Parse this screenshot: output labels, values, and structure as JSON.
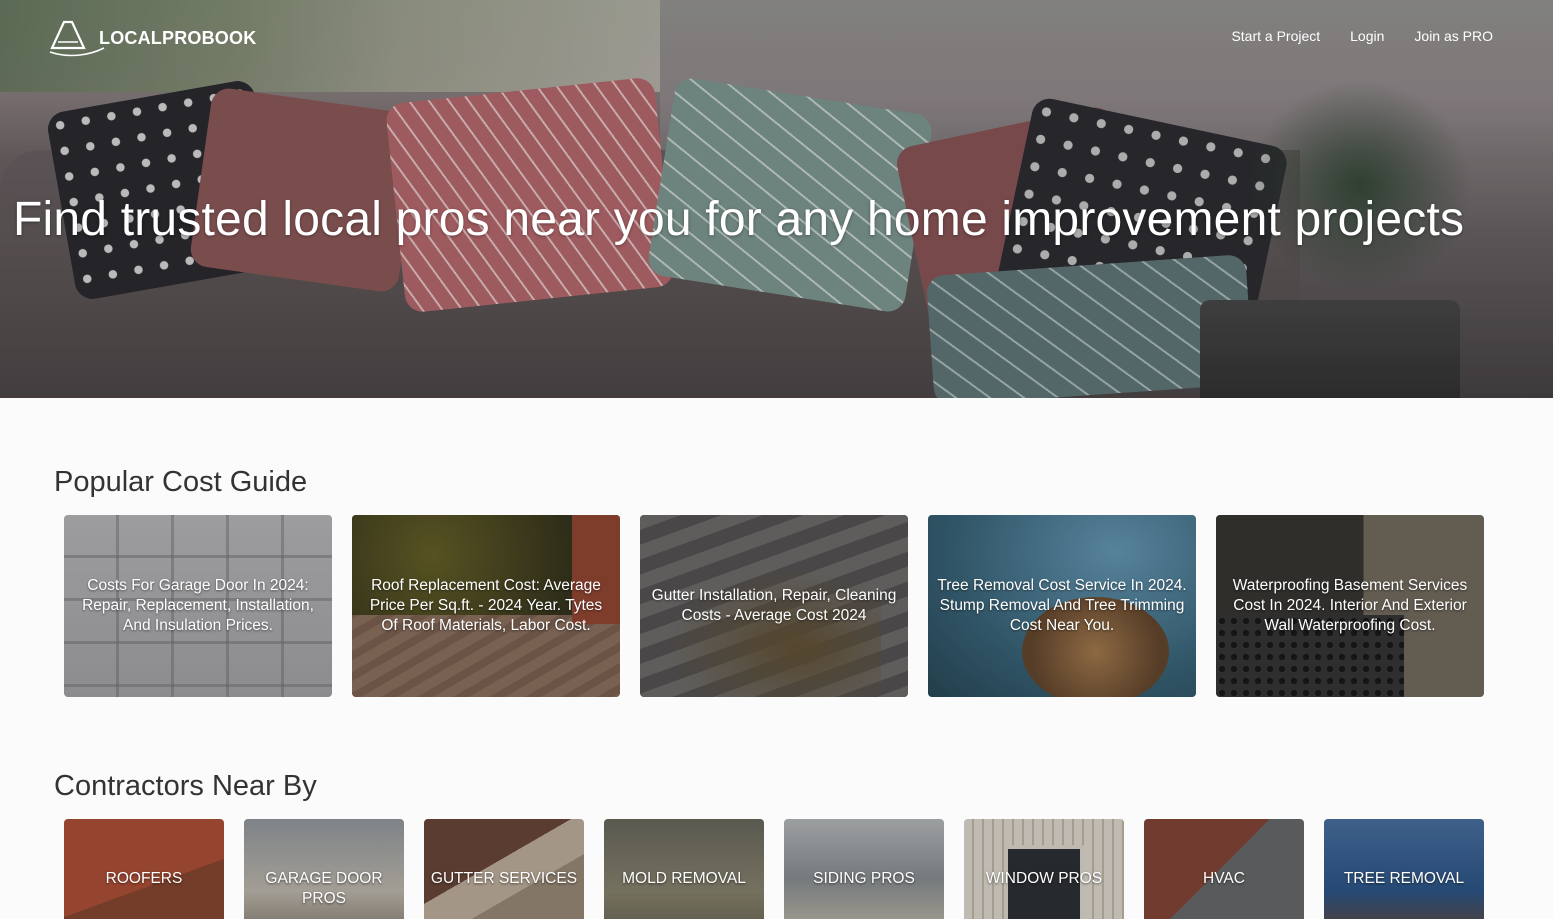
{
  "brand": {
    "name": "LOCALPROBOOK",
    "logo_icon": "house-roof-logo-icon"
  },
  "nav": {
    "links": [
      {
        "label": "Start a Project"
      },
      {
        "label": "Login"
      },
      {
        "label": "Join as PRO"
      }
    ]
  },
  "hero": {
    "title": "Find trusted local pros near you for any home improvement projects"
  },
  "cost_guide": {
    "title": "Popular Cost Guide",
    "items": [
      {
        "label": "Costs For Garage Door In 2024: Repair, Replacement, Installation, And Insulation Prices."
      },
      {
        "label": "Roof Replacement Cost: Average Price Per Sq.ft. - 2024 Year. Tytes Of Roof Materials, Labor Cost."
      },
      {
        "label": "Gutter Installation, Repair, Cleaning Costs - Average Cost 2024"
      },
      {
        "label": "Tree Removal Cost Service In 2024. Stump Removal And Tree Trimming Cost Near You."
      },
      {
        "label": "Waterproofing Basement Services Cost In 2024. Interior And Exterior Wall Waterproofing Cost."
      }
    ]
  },
  "contractors": {
    "title": "Contractors Near By",
    "items": [
      {
        "label": "ROOFERS"
      },
      {
        "label": "GARAGE DOOR PROS"
      },
      {
        "label": "GUTTER SERVICES"
      },
      {
        "label": "MOLD REMOVAL"
      },
      {
        "label": "SIDING PROS"
      },
      {
        "label": "WINDOW PROS"
      },
      {
        "label": "HVAC"
      },
      {
        "label": "TREE REMOVAL"
      }
    ]
  }
}
